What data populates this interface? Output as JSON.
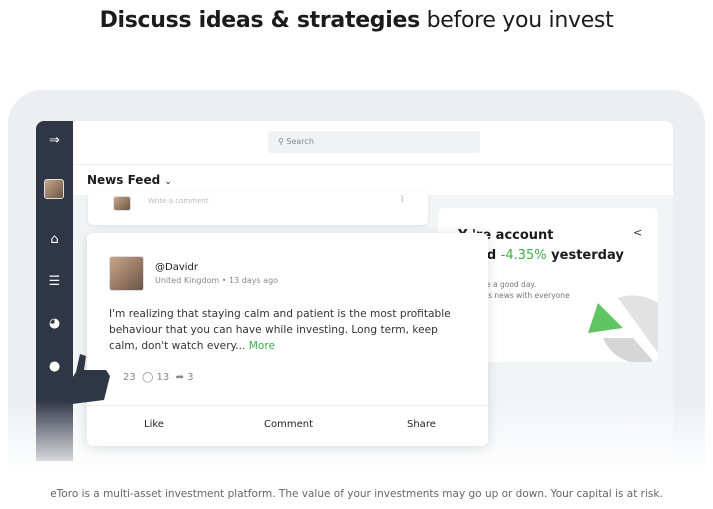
{
  "headline": {
    "bold": "Discuss ideas & strategies",
    "regular": " before you invest"
  },
  "search": {
    "placeholder": "Search"
  },
  "feed": {
    "title": "News Feed",
    "comment_placeholder": "Write a comment"
  },
  "post": {
    "username": "@Davidr",
    "location": "United Kingdom",
    "time": "13 days ago",
    "text": "I'm realizing that staying calm and patient is the most profitable behaviour that you can have while investing. Long term, keep calm, don't watch every...",
    "more": "More",
    "likes": "23",
    "comments": "13",
    "shares": "3",
    "actions": {
      "like": "Like",
      "comment": "Comment",
      "share": "Share"
    }
  },
  "promo": {
    "line1": "Y  're account",
    "line2a": "ed ",
    "change": "-4.35%",
    "line2b": " yesterday",
    "sub1": "e a good day.",
    "sub2": "is news with everyone",
    "accent": "#3fae49"
  },
  "disclaimer": "eToro is a multi-asset investment platform. The value of your investments may go up or down. Your capital is at risk."
}
